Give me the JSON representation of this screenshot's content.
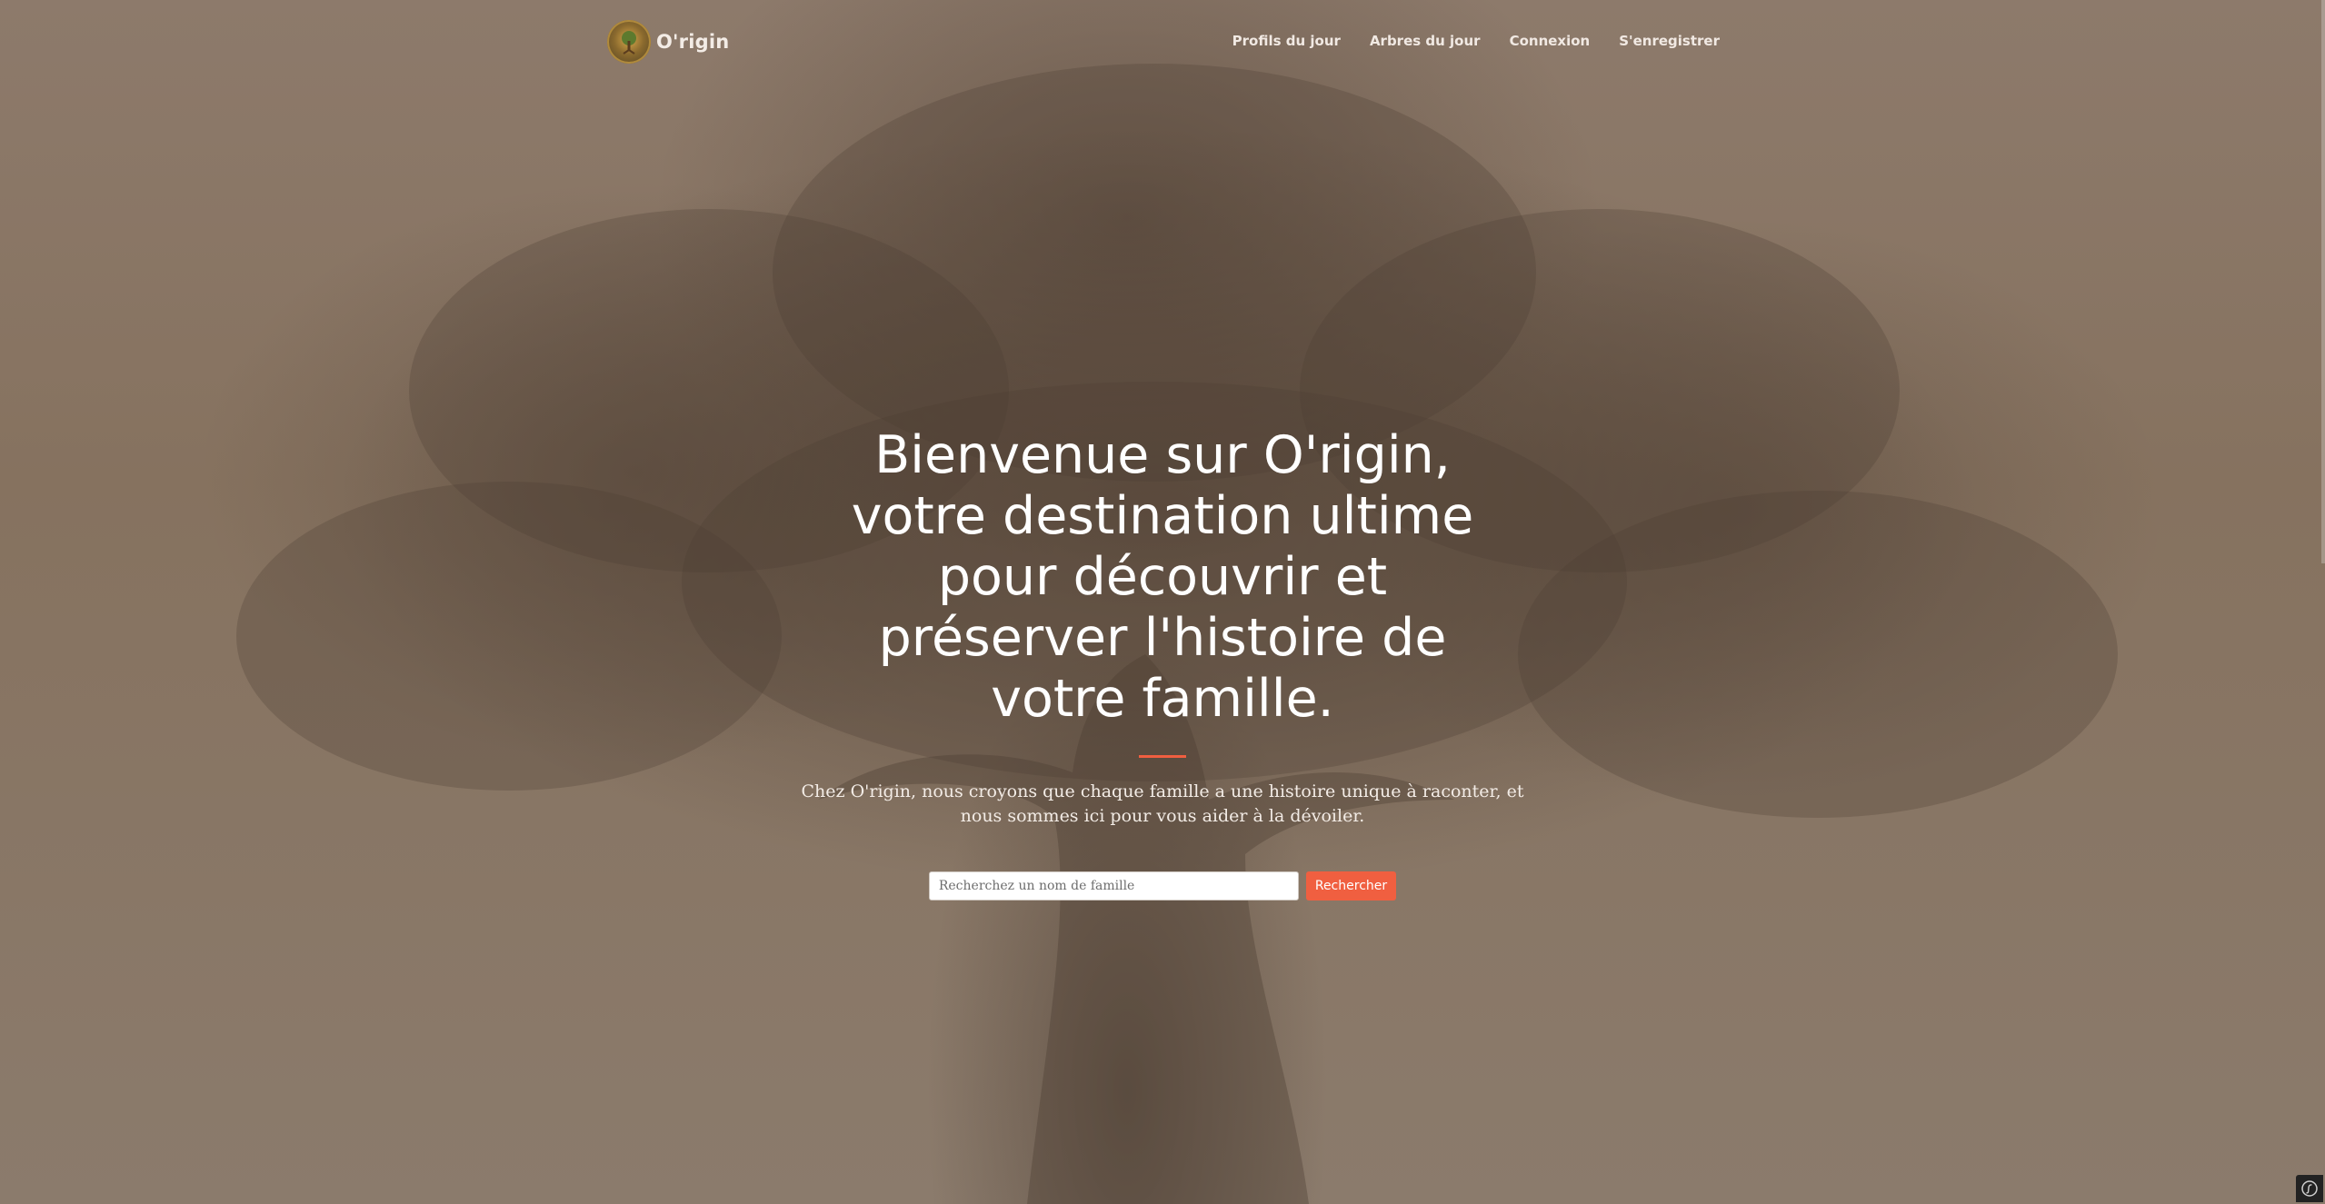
{
  "header": {
    "brand_name": "O'rigin",
    "logo_icon": "tree-logo-icon",
    "nav": [
      {
        "label": "Profils du jour"
      },
      {
        "label": "Arbres du jour"
      },
      {
        "label": "Connexion"
      },
      {
        "label": "S'enregistrer"
      }
    ]
  },
  "hero": {
    "title": "Bienvenue sur O'rigin, votre destination ultime pour découvrir et préserver l'histoire de votre famille.",
    "subtitle": "Chez O'rigin, nous croyons que chaque famille a une histoire unique à raconter, et nous sommes ici pour vous aider à la dévoiler.",
    "search": {
      "placeholder": "Recherchez un nom de famille",
      "value": "",
      "button_label": "Rechercher"
    }
  },
  "colors": {
    "accent": "#f05f40",
    "background_tone": "#8a7768",
    "text_light": "#ffffff"
  },
  "debug_toolbar_icon": "symfony-icon"
}
